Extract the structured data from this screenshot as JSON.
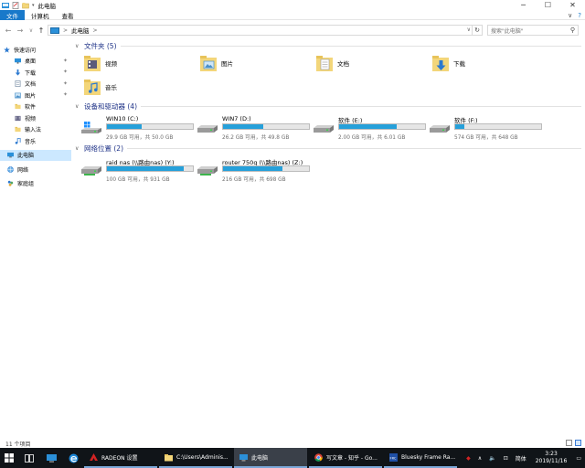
{
  "titlebar": {
    "title": "此电脑",
    "controls": [
      "─",
      "☐",
      "✕"
    ]
  },
  "ribbon": {
    "tabs": [
      "文件",
      "计算机",
      "查看"
    ],
    "expand_glyph": "∨",
    "help_glyph": "?"
  },
  "nav": {
    "back": "←",
    "forward": "→",
    "recent": "∨",
    "up": "↑"
  },
  "address": {
    "crumb_sep": ">",
    "crumb": "此电脑",
    "refresh_glyph": "↻",
    "dropdown_glyph": "∨"
  },
  "search": {
    "placeholder": "搜索\"此电脑\"",
    "icon_glyph": "⚲"
  },
  "sidebar": {
    "items": [
      {
        "label": "快速访问",
        "icon": "star-icon",
        "color": "#2b79d0",
        "pinned": false
      },
      {
        "label": "桌面",
        "icon": "desktop-icon",
        "color": "#2b90d9",
        "pinned": true
      },
      {
        "label": "下载",
        "icon": "download-icon",
        "color": "#2b79d0",
        "pinned": true
      },
      {
        "label": "文档",
        "icon": "documents-icon",
        "color": "#7a8fa6",
        "pinned": true
      },
      {
        "label": "图片",
        "icon": "pictures-icon",
        "color": "#4a8fc7",
        "pinned": true
      },
      {
        "label": "软件",
        "icon": "folder-icon",
        "color": "#e8c35a",
        "pinned": false
      },
      {
        "label": "视频",
        "icon": "videos-icon",
        "color": "#6a6a8a",
        "pinned": false
      },
      {
        "label": "输入法",
        "icon": "folder-icon",
        "color": "#e8c35a",
        "pinned": false
      },
      {
        "label": "音乐",
        "icon": "music-icon",
        "color": "#2b79d0",
        "pinned": false
      },
      {
        "label": "此电脑",
        "icon": "computer-icon",
        "color": "#2b90d9",
        "pinned": false
      },
      {
        "label": "网络",
        "icon": "network-icon",
        "color": "#2b79d0",
        "pinned": false
      },
      {
        "label": "家庭组",
        "icon": "homegroup-icon",
        "color": "#2b79d0",
        "pinned": false
      }
    ],
    "pin_glyph": "📌"
  },
  "groups": {
    "folders_title": "文件夹 (5)",
    "devices_title": "设备和驱动器 (4)",
    "network_title": "网络位置 (2)"
  },
  "folders": [
    {
      "label": "视频",
      "icon": "videos-folder-icon"
    },
    {
      "label": "图片",
      "icon": "pictures-folder-icon"
    },
    {
      "label": "文档",
      "icon": "documents-folder-icon"
    },
    {
      "label": "下载",
      "icon": "downloads-folder-icon"
    },
    {
      "label": "音乐",
      "icon": "music-folder-icon"
    }
  ],
  "drives": [
    {
      "name": "WIN10 (C:)",
      "size": "29.9 GB 可用，共 50.0 GB",
      "used_fraction": 0.4,
      "icon": "windows-drive-icon"
    },
    {
      "name": "WIN7 (D:)",
      "size": "26.2 GB 可用，共 49.8 GB",
      "used_fraction": 0.47,
      "icon": "hard-drive-icon"
    },
    {
      "name": "软件 (E:)",
      "size": "2.00 GB 可用，共 6.01 GB",
      "used_fraction": 0.67,
      "icon": "hard-drive-icon"
    },
    {
      "name": "软件 (F:)",
      "size": "574 GB 可用，共 648 GB",
      "used_fraction": 0.11,
      "icon": "hard-drive-icon"
    }
  ],
  "network_drives": [
    {
      "name": "raid nas (\\\\路由nas) (Y:)",
      "size": "100 GB 可用，共 931 GB",
      "used_fraction": 0.89,
      "icon": "network-drive-icon"
    },
    {
      "name": "router 750g (\\\\路由nas) (Z:)",
      "size": "216 GB 可用，共 698 GB",
      "used_fraction": 0.69,
      "icon": "network-drive-icon"
    }
  ],
  "status": {
    "count": "11 个项目"
  },
  "taskbar": {
    "apps": [
      {
        "label": "RADEON 设置",
        "icon": "radeon-icon",
        "color": "#d42323",
        "active": false
      },
      {
        "label": "C:\\Users\\Adminis...",
        "icon": "folder-icon",
        "color": "#e8c35a",
        "active": false
      },
      {
        "label": "此电脑",
        "icon": "computer-icon",
        "color": "#2b90d9",
        "active": true
      },
      {
        "label": "写文章 - 知乎 - Go...",
        "icon": "chrome-icon",
        "color": "#e0b22a",
        "active": false
      },
      {
        "label": "Bluesky Frame Ra...",
        "icon": "frc-icon",
        "color": "#1f4fa5",
        "active": false
      }
    ],
    "tray": {
      "ime": "简体",
      "time": "3:23",
      "date": "2019/11/16"
    }
  }
}
